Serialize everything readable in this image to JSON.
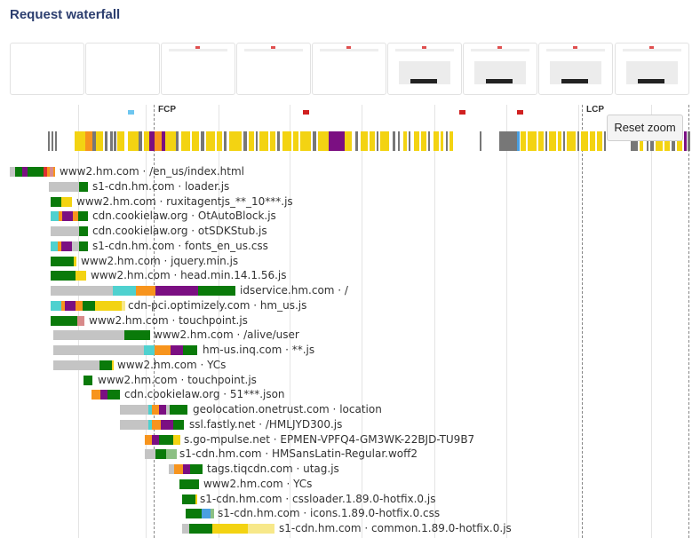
{
  "title": "Request waterfall",
  "filmstrip": [
    {
      "state": "blank"
    },
    {
      "state": "blank"
    },
    {
      "state": "partial"
    },
    {
      "state": "partial"
    },
    {
      "state": "partial"
    },
    {
      "state": "content"
    },
    {
      "state": "content"
    },
    {
      "state": "content"
    },
    {
      "state": "content"
    }
  ],
  "markers": {
    "fcp": "FCP",
    "lcp": "LCP"
  },
  "reset_zoom": "Reset zoom",
  "colors": {
    "gray": "#c4c4c4",
    "teal": "#4fd1cf",
    "orange": "#f7941d",
    "purple": "#7b0f82",
    "green": "#0a7a0a",
    "yellow": "#f3d312",
    "lightyellow": "#f7e88a",
    "blue": "#4a9fe0",
    "pink": "#d88a8a",
    "red": "#e03030",
    "darkgray": "#777777",
    "lightgreen": "#8cc084"
  },
  "requests": [
    {
      "label": "www2.hm.com · /en_us/index.html"
    },
    {
      "label": "s1-cdn.hm.com · loader.js"
    },
    {
      "label": "www2.hm.com · ruxitagentjs_**_10***.js"
    },
    {
      "label": "cdn.cookielaw.org · OtAutoBlock.js"
    },
    {
      "label": "cdn.cookielaw.org · otSDKStub.js"
    },
    {
      "label": "s1-cdn.hm.com · fonts_en_us.css"
    },
    {
      "label": "www2.hm.com · jquery.min.js"
    },
    {
      "label": "www2.hm.com · head.min.14.1.56.js"
    },
    {
      "label": "idservice.hm.com · /"
    },
    {
      "label": "cdn-pci.optimizely.com · hm_us.js"
    },
    {
      "label": "www2.hm.com · touchpoint.js"
    },
    {
      "label": "www2.hm.com · /alive/user"
    },
    {
      "label": "hm-us.inq.com · **.js"
    },
    {
      "label": "www2.hm.com · YCs"
    },
    {
      "label": "www2.hm.com · touchpoint.js"
    },
    {
      "label": "cdn.cookielaw.org · 51***.json"
    },
    {
      "label": "geolocation.onetrust.com · location"
    },
    {
      "label": "ssl.fastly.net · /HMLJYD300.js"
    },
    {
      "label": "s.go-mpulse.net · EPMEN-VPFQ4-GM3WK-22BJD-TU9B7"
    },
    {
      "label": "s1-cdn.hm.com · HMSansLatin-Regular.woff2"
    },
    {
      "label": "tags.tiqcdn.com · utag.js"
    },
    {
      "label": "www2.hm.com · YCs"
    },
    {
      "label": "s1-cdn.hm.com · cssloader.1.89.0-hotfix.0.js"
    },
    {
      "label": "s1-cdn.hm.com · icons.1.89.0-hotfix.0.css"
    },
    {
      "label": "s1-cdn.hm.com · common.1.89.0-hotfix.0.js"
    }
  ]
}
